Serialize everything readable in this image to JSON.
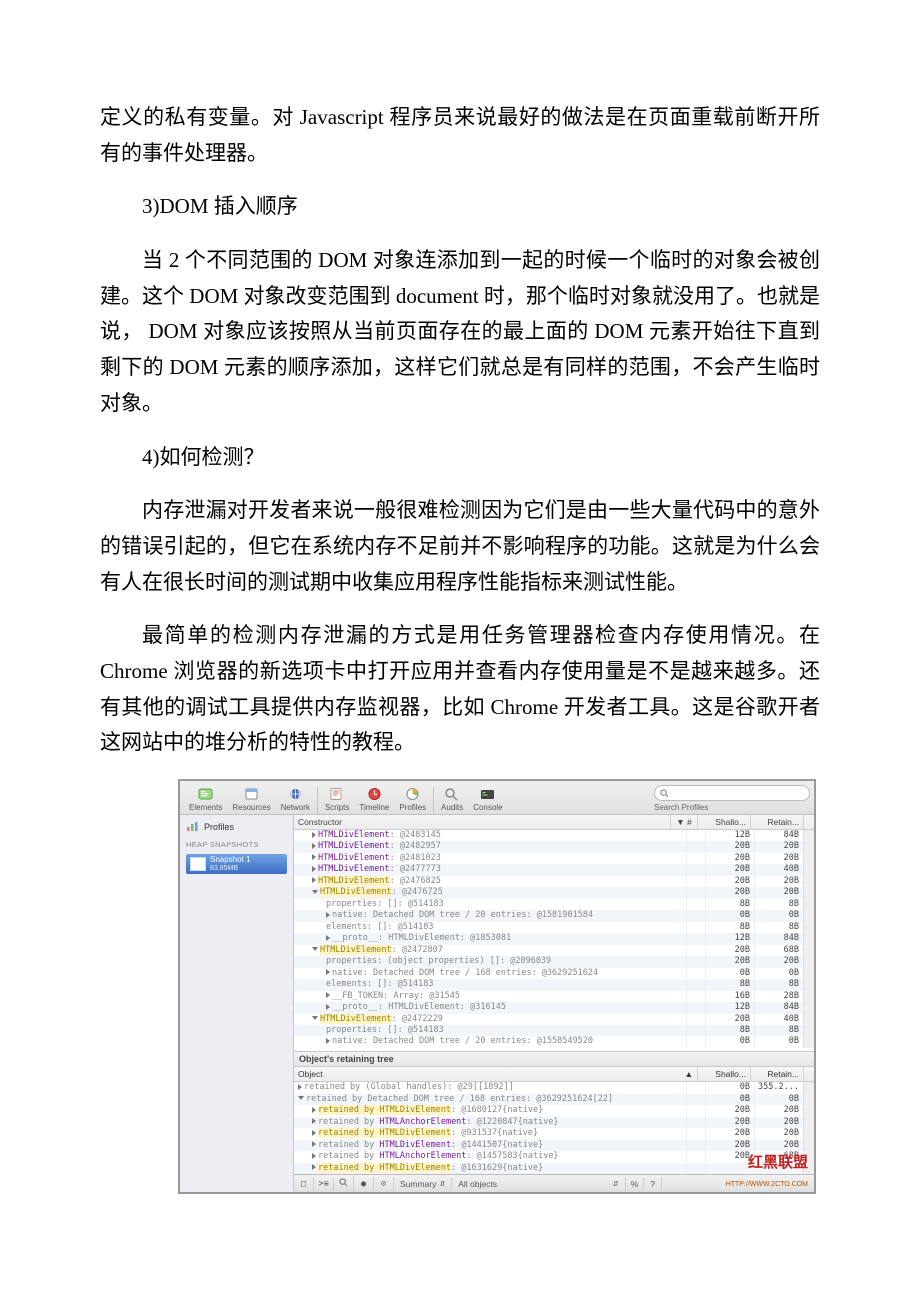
{
  "document": {
    "paragraphs": {
      "p1": "定义的私有变量。对 Javascript 程序员来说最好的做法是在页面重载前断开所有的事件处理器。",
      "p2": "3)DOM 插入顺序",
      "p3": "当 2 个不同范围的 DOM 对象连添加到一起的时候一个临时的对象会被创建。这个 DOM 对象改变范围到 document 时，那个临时对象就没用了。也就是说， DOM 对象应该按照从当前页面存在的最上面的 DOM 元素开始往下直到剩下的 DOM 元素的顺序添加，这样它们就总是有同样的范围，不会产生临时对象。",
      "p4": "4)如何检测？",
      "p5": "内存泄漏对开发者来说一般很难检测因为它们是由一些大量代码中的意外的错误引起的，但它在系统内存不足前并不影响程序的功能。这就是为什么会有人在很长时间的测试期中收集应用程序性能指标来测试性能。",
      "p6": "最简单的检测内存泄漏的方式是用任务管理器检查内存使用情况。在 Chrome 浏览器的新选项卡中打开应用并查看内存使用量是不是越来越多。还有其他的调试工具提供内存监视器，比如 Chrome 开发者工具。这是谷歌开者这网站中的堆分析的特性的教程。"
    }
  },
  "devtools": {
    "toolbar": {
      "tabs": [
        "Elements",
        "Resources",
        "Network",
        "Scripts",
        "Timeline",
        "Profiles",
        "Audits",
        "Console"
      ],
      "search_label": "Search Profiles"
    },
    "sidebar": {
      "profiles_label": "Profiles",
      "section": "HEAP SNAPSHOTS",
      "snapshot": {
        "title": "Snapshot 1",
        "sub": "83.85MB"
      }
    },
    "columns": {
      "constructor": "Constructor",
      "dist": "▼ #",
      "shallow": "Shallo...",
      "retain": "Retain..."
    },
    "tree": [
      {
        "indent": 1,
        "arrow": "r",
        "cls": "HTMLDivElement",
        "addr": "@2483145",
        "s": "12B",
        "r": "84B"
      },
      {
        "indent": 1,
        "arrow": "r",
        "cls": "HTMLDivElement",
        "addr": "@2482957",
        "s": "20B",
        "r": "20B"
      },
      {
        "indent": 1,
        "arrow": "r",
        "cls": "HTMLDivElement",
        "addr": "@2481023",
        "s": "20B",
        "r": "20B"
      },
      {
        "indent": 1,
        "arrow": "r",
        "cls": "HTMLDivElement",
        "addr": "@2477773",
        "s": "20B",
        "r": "40B"
      },
      {
        "indent": 1,
        "arrow": "r",
        "hl": true,
        "cls": "HTMLDivElement",
        "addr": "@2476825",
        "s": "20B",
        "r": "20B"
      },
      {
        "indent": 1,
        "arrow": "d",
        "hl": true,
        "cls": "HTMLDivElement",
        "addr": "@2476725",
        "s": "20B",
        "r": "20B"
      },
      {
        "indent": 2,
        "txt": "properties: []: @514183",
        "s": "8B",
        "r": "8B"
      },
      {
        "indent": 2,
        "arrow": "r",
        "txt": "native: Detached DOM tree / 20 entries: @1581901584",
        "s": "0B",
        "r": "0B"
      },
      {
        "indent": 2,
        "txt": "elements: []: @514183",
        "s": "8B",
        "r": "8B"
      },
      {
        "indent": 2,
        "arrow": "r",
        "txt": "__proto__: HTMLDivElement: @1853081",
        "s": "12B",
        "r": "84B"
      },
      {
        "indent": 1,
        "arrow": "d",
        "hl": true,
        "cls": "HTMLDivElement",
        "addr": "@2472807",
        "s": "20B",
        "r": "68B"
      },
      {
        "indent": 2,
        "txt": "properties: (object properties) []: @2096039",
        "s": "20B",
        "r": "20B"
      },
      {
        "indent": 2,
        "arrow": "r",
        "txt": "native: Detached DOM tree / 168 entries: @3629251624",
        "s": "0B",
        "r": "0B"
      },
      {
        "indent": 2,
        "txt": "elements: []: @514183",
        "s": "8B",
        "r": "8B"
      },
      {
        "indent": 2,
        "arrow": "r",
        "txt": "__FB_TOKEN: Array: @31545",
        "s": "16B",
        "r": "28B"
      },
      {
        "indent": 2,
        "arrow": "r",
        "txt": "__proto__: HTMLDivElement: @316145",
        "s": "12B",
        "r": "84B"
      },
      {
        "indent": 1,
        "arrow": "d",
        "hl": true,
        "cls": "HTMLDivElement",
        "addr": "@2472229",
        "s": "20B",
        "r": "40B"
      },
      {
        "indent": 2,
        "txt": "properties: []: @514183",
        "s": "8B",
        "r": "8B"
      },
      {
        "indent": 2,
        "arrow": "r",
        "txt": "native: Detached DOM tree / 20 entries: @1558549520",
        "s": "0B",
        "r": "0B"
      }
    ],
    "retaining": {
      "title": "Object's retaining tree",
      "cols": {
        "object": "Object",
        "shallow": "Shallo...",
        "retain": "Retain..."
      },
      "rows": [
        {
          "indent": 0,
          "arrow": "r",
          "txt": "retained by (Global handles): @29[[1892]]",
          "s": "0B",
          "r": "355.2..."
        },
        {
          "indent": 0,
          "arrow": "d",
          "txt": "retained by Detached DOM tree / 168 entries: @3629251624[22]",
          "s": "0B",
          "r": "0B"
        },
        {
          "indent": 1,
          "arrow": "r",
          "hl": true,
          "pre": "retained by ",
          "cls": "HTMLDivElement",
          "addr": "@1680127",
          "suf": "{native}",
          "s": "20B",
          "r": "20B"
        },
        {
          "indent": 1,
          "arrow": "r",
          "pre": "retained by ",
          "cls2": "HTMLAnchorElement",
          "addr": "@1220847",
          "suf": "{native}",
          "s": "20B",
          "r": "20B"
        },
        {
          "indent": 1,
          "arrow": "r",
          "hl": true,
          "pre": "retained by ",
          "cls": "HTMLDivElement",
          "addr": "@931537",
          "suf": "{native}",
          "s": "20B",
          "r": "20B"
        },
        {
          "indent": 1,
          "arrow": "r",
          "pre": "retained by ",
          "cls2": "HTMLDivElement",
          "addr": "@1441507",
          "suf": "{native}",
          "s": "20B",
          "r": "20B"
        },
        {
          "indent": 1,
          "arrow": "r",
          "pre": "retained by ",
          "cls2": "HTMLAnchorElement",
          "addr": "@1457583",
          "suf": "{native}",
          "s": "20B",
          "r": "68B"
        },
        {
          "indent": 1,
          "arrow": "r",
          "hl": true,
          "pre": "retained by ",
          "cls": "HTMLDivElement",
          "addr": "@1631629",
          "suf": "{native}",
          "s": "",
          "r": ""
        }
      ]
    },
    "footer": {
      "summary": "Summary",
      "all_objects": "All objects",
      "percent": "%",
      "question": "?"
    },
    "watermark": {
      "text": "红黑联盟",
      "url": "HTTP://WWW.2CTO.COM"
    }
  }
}
